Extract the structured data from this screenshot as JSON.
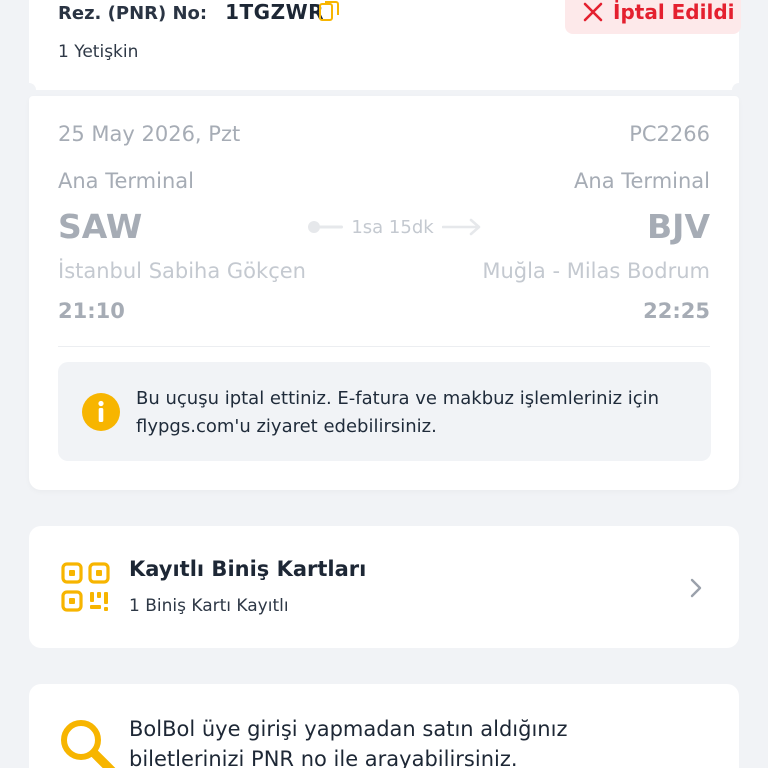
{
  "booking": {
    "pnr_label": "Rez. (PNR) No:",
    "pnr_value": "1TGZWR",
    "passengers": "1 Yetişkin",
    "status": "İptal Edildi",
    "icons": [
      "copy-icon",
      "close-x-icon"
    ]
  },
  "flight": {
    "date": "25 May 2026, Pzt",
    "flight_number": "PC2266",
    "origin": {
      "terminal": "Ana Terminal",
      "code": "SAW",
      "city": "İstanbul Sabiha Gökçen",
      "time": "21:10"
    },
    "destination": {
      "terminal": "Ana Terminal",
      "code": "BJV",
      "city": "Muğla - Milas Bodrum",
      "time": "22:25"
    },
    "duration": "1sa 15dk",
    "info_message": "Bu uçuşu iptal ettiniz. E-fatura ve makbuz işlemleriniz için flypgs.com'u ziyaret edebilirsiniz."
  },
  "boarding_passes": {
    "title": "Kayıtlı Biniş Kartları",
    "subtitle": "1 Biniş Kartı Kayıtlı"
  },
  "bolbol": {
    "text": "BolBol üye girişi yapmadan satın aldığınız biletlerinizi PNR no ile arayabilirsiniz."
  },
  "colors": {
    "accent_yellow": "#f7b500",
    "cancel_red": "#e4202f",
    "cancel_bg": "#fde9ea",
    "muted_gray": "#a6acb5",
    "page_bg": "#f1f3f6"
  }
}
